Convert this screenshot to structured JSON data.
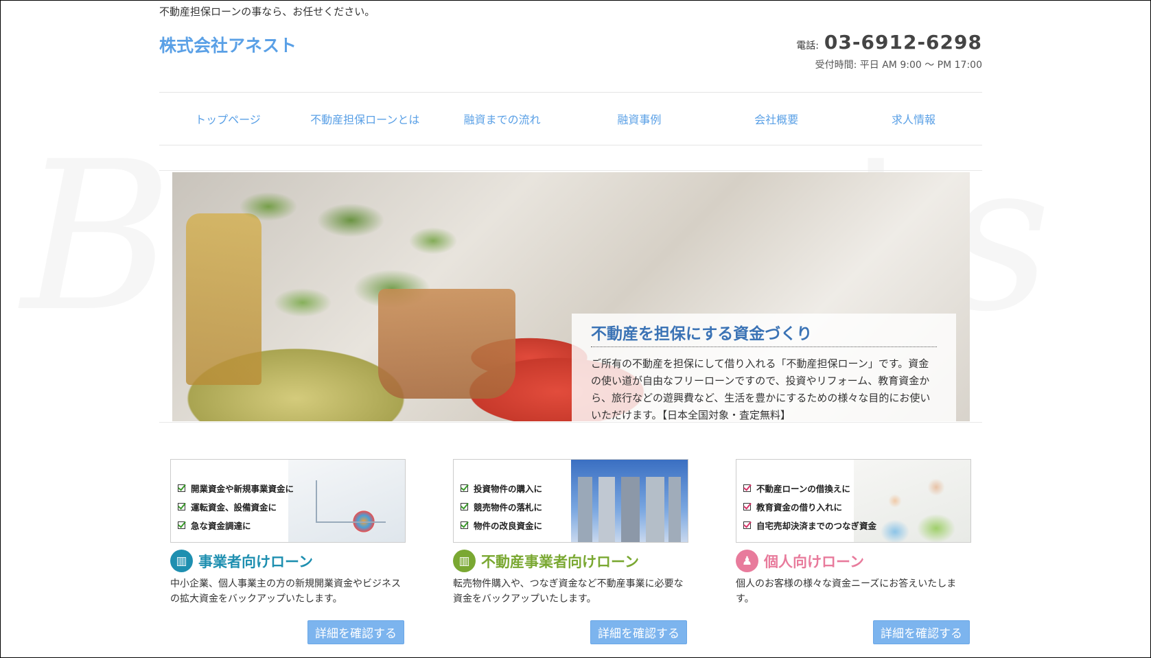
{
  "watermark": "Buyer's Room",
  "header": {
    "tagline": "不動産担保ローンの事なら、お任せください。",
    "logo": "株式会社アネスト",
    "phone_label": "電話:",
    "phone_number": "03-6912-6298",
    "hours": "受付時間: 平日 AM 9:00 ～ PM 17:00"
  },
  "nav": {
    "items": [
      {
        "label": "トップページ"
      },
      {
        "label": "不動産担保ローンとは"
      },
      {
        "label": "融資までの流れ"
      },
      {
        "label": "融資事例"
      },
      {
        "label": "会社概要"
      },
      {
        "label": "求人情報"
      }
    ]
  },
  "hero": {
    "title": "不動産を担保にする資金づくり",
    "text": "ご所有の不動産を担保にして借り入れる「不動産担保ローン」です。資金の使い道が自由なフリーローンですので、投資やリフォーム、教育資金から、旅行などの遊興費など、生活を豊かにするための様々な目的にお使いいただけます。【日本全国対象・査定無料】"
  },
  "cards": [
    {
      "checks": [
        "開業資金や新規事業資金に",
        "運転資金、設備資金に",
        "急な資金調達に"
      ],
      "heading": "事業者向けローン",
      "description": "中小企業、個人事業主の方の新規開業資金やビジネスの拡大資金をバックアップいたします。",
      "button": "詳細を確認する",
      "icon": "building-icon",
      "color": "#1e8fb0"
    },
    {
      "checks": [
        "投資物件の購入に",
        "競売物件の落札に",
        "物件の改良資金に"
      ],
      "heading": "不動産事業者向けローン",
      "description": "転売物件購入や、つなぎ資金など不動産事業に必要な資金をバックアップいたします。",
      "button": "詳細を確認する",
      "icon": "building-icon",
      "color": "#7aa832"
    },
    {
      "checks": [
        "不動産ローンの借換えに",
        "教育資金の借り入れに",
        "自宅売却決済までのつなぎ資金"
      ],
      "heading": "個人向けローン",
      "description": "個人のお客様の様々な資金ニーズにお答えいたします。",
      "button": "詳細を確認する",
      "icon": "person-icon",
      "color": "#e87b9c"
    }
  ]
}
